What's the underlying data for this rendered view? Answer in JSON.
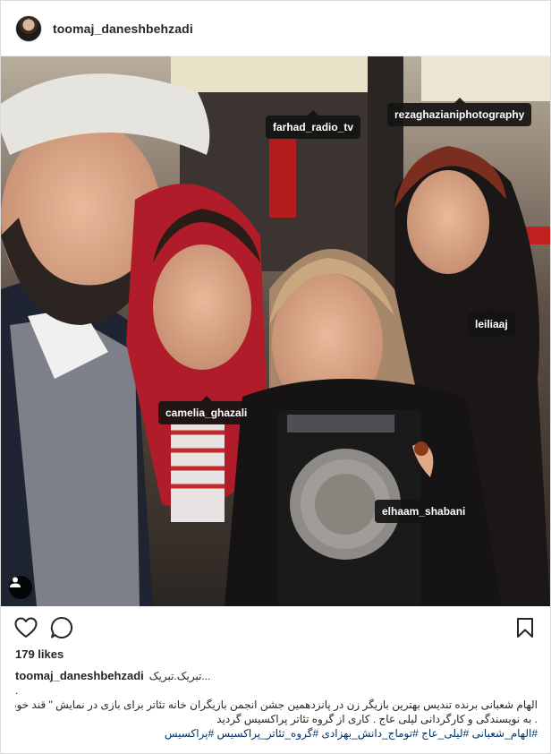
{
  "post": {
    "username": "toomaj_daneshbehzadi",
    "tags": [
      {
        "id": "tag-farhad",
        "label": "farhad_radio_tv"
      },
      {
        "id": "tag-reza",
        "label": "rezaghazianiphotography"
      },
      {
        "id": "tag-leila",
        "label": "leiliaaj"
      },
      {
        "id": "tag-camelia",
        "label": "camelia_ghazali"
      },
      {
        "id": "tag-elhaam",
        "label": "elhaam_shabani"
      }
    ],
    "likes": "179 likes",
    "caption": {
      "user": "toomaj_daneshbehzadi",
      "first_text": "تبریک.تبریک...",
      "dot": ".",
      "line1": "الهام شعبانی برنده تندیس بهترین بازیگر زن در پانزدهمین جشن انجمن بازیگران خانه تئاتر برای بازی در نمایش \" قند خون \"",
      "line2": ". به نویسندگی و کارگردانی لیلی عاج . کاری از گروه تئاتر پراکسیس گردید",
      "hashtags": "#الهام_شعبانی #لیلی_عاج #توماج_دانش_بهزادی #گروه_تئاتر_پراکسیس #پراکسیس"
    }
  },
  "icons": {
    "avatar": "avatar-photo",
    "people": "person-tag-icon",
    "like": "heart-icon",
    "comment": "comment-bubble-icon",
    "save": "bookmark-icon"
  },
  "colors": {
    "tag_bg": "#141414",
    "hashtag": "#003569",
    "text": "#262626"
  }
}
